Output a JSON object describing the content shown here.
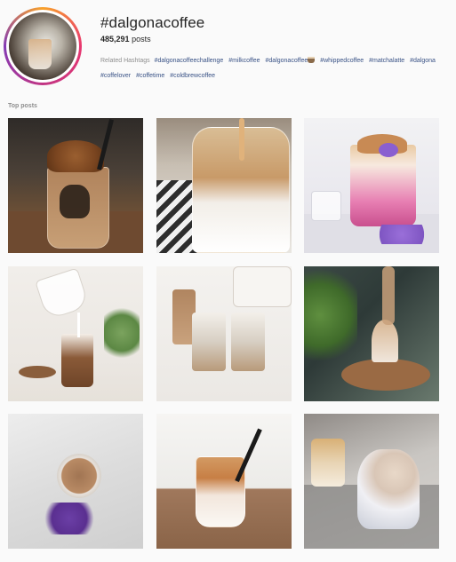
{
  "header": {
    "hashtag": "#dalgonacoffee",
    "post_count": "485,291",
    "post_count_suffix": "posts",
    "related_label": "Related Hashtags",
    "related_tags": [
      "#dalgonacoffeechallenge",
      "#milkcoffee",
      "#dalgonacoffee",
      "#whippedcoffee",
      "#matchalatte",
      "#dalgona",
      "#coffelover",
      "#coffetime",
      "#coldbrewcoffee"
    ]
  },
  "section": {
    "label": "Top posts"
  },
  "posts": [
    {
      "name": "post-1"
    },
    {
      "name": "post-2"
    },
    {
      "name": "post-3"
    },
    {
      "name": "post-4"
    },
    {
      "name": "post-5"
    },
    {
      "name": "post-6"
    },
    {
      "name": "post-7"
    },
    {
      "name": "post-8"
    },
    {
      "name": "post-9"
    }
  ],
  "colors": {
    "hashtag_link": "#385185",
    "muted_text": "#8e8e8e",
    "background": "#fafafa"
  }
}
